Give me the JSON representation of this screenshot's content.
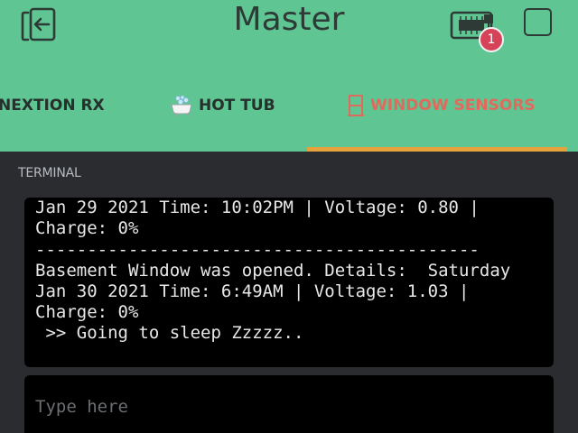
{
  "header": {
    "title": "Master",
    "notification_count": "1",
    "accent_color": "#5fc592"
  },
  "tabs": [
    {
      "label": "NEXTION RX",
      "icon": "none",
      "active": false
    },
    {
      "label": "HOT TUB",
      "icon": "bathtub-icon",
      "active": false
    },
    {
      "label": "WINDOW SENSORS",
      "icon": "door-icon",
      "active": true
    }
  ],
  "terminal": {
    "label": "TERMINAL",
    "lines": [
      "Jan 29 2021 Time: 10:02PM | Voltage: 0.80 |",
      "Charge: 0%",
      "-------------------------------------------",
      "Basement Window was opened. Details:  Saturday",
      "Jan 30 2021 Time: 6:49AM | Voltage: 1.03 |",
      "Charge: 0%",
      " >> Going to sleep Zzzzz.."
    ]
  },
  "input": {
    "placeholder": "Type here",
    "value": ""
  },
  "colors": {
    "active_tab_text": "#df6b5f",
    "tab_underline": "#e6a23c",
    "badge": "#d64359",
    "background": "#2b2c30"
  }
}
